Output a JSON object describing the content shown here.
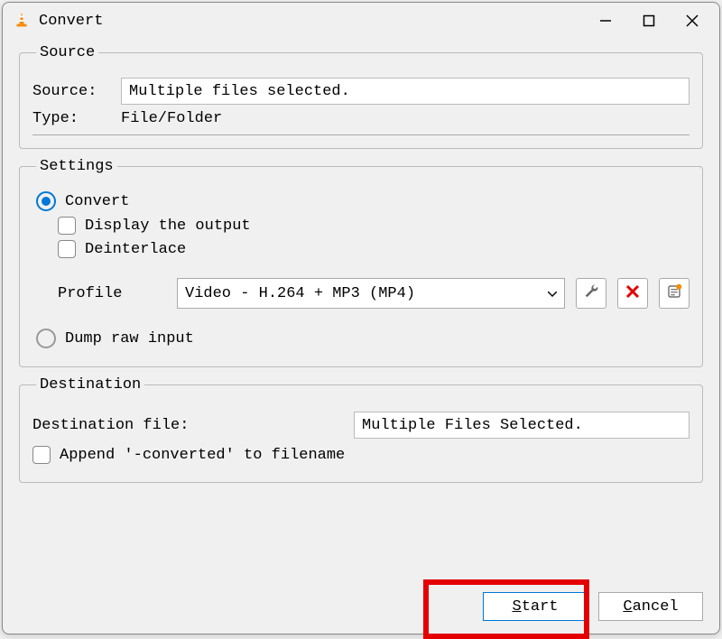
{
  "window": {
    "title": "Convert"
  },
  "source_group": {
    "legend": "Source",
    "source_label": "Source:",
    "source_value": "Multiple files selected.",
    "type_label": "Type:",
    "type_value": "File/Folder"
  },
  "settings_group": {
    "legend": "Settings",
    "convert_label": "Convert",
    "display_output_label": "Display the output",
    "deinterlace_label": "Deinterlace",
    "profile_label": "Profile",
    "profile_value": "Video - H.264 + MP3 (MP4)",
    "dump_raw_label": "Dump raw input"
  },
  "destination_group": {
    "legend": "Destination",
    "dest_file_label": "Destination file:",
    "dest_file_value": "Multiple Files Selected.",
    "append_label": "Append '-converted' to filename"
  },
  "footer": {
    "start_label": "Start",
    "cancel_label": "Cancel"
  }
}
